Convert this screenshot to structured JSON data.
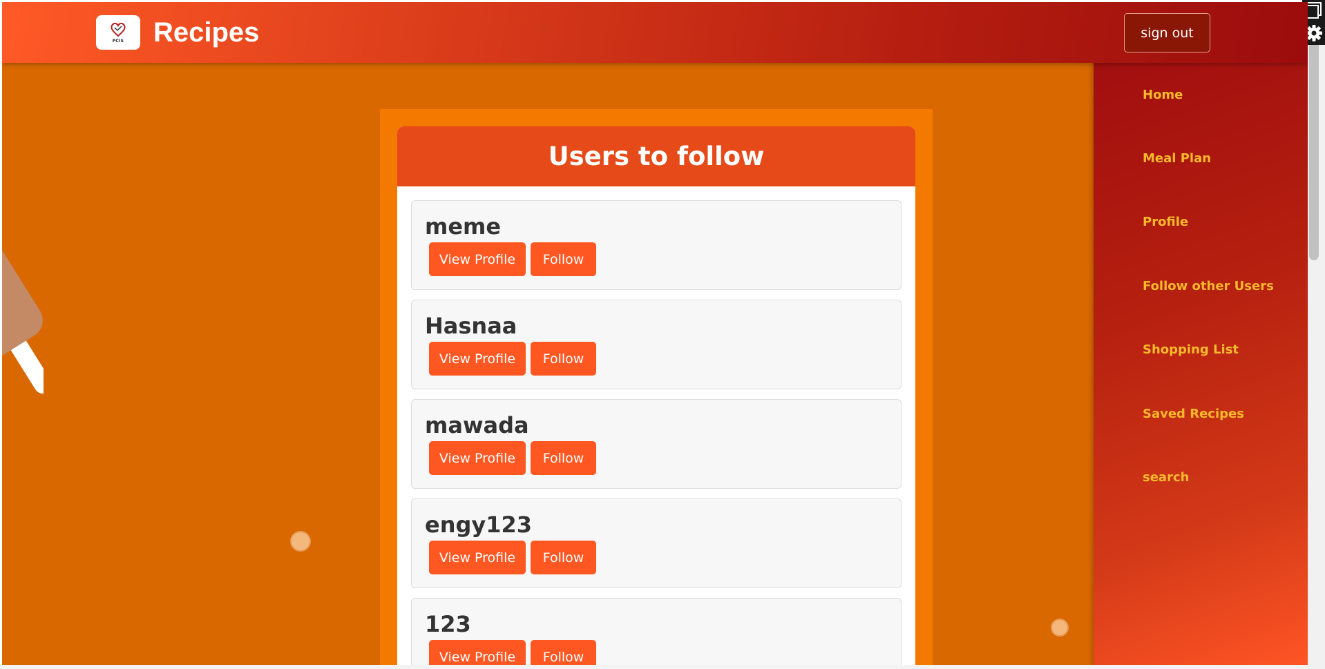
{
  "header": {
    "app_title": "Recipes",
    "logo_text": "PCIS",
    "signout_label": "sign out"
  },
  "sidebar": {
    "items": [
      {
        "label": "Home"
      },
      {
        "label": "Meal Plan"
      },
      {
        "label": "Profile"
      },
      {
        "label": "Follow other Users"
      },
      {
        "label": "Shopping List"
      },
      {
        "label": "Saved Recipes"
      },
      {
        "label": "search"
      }
    ]
  },
  "main": {
    "title": "Users to follow",
    "view_profile_label": "View Profile",
    "follow_label": "Follow",
    "users": [
      {
        "name": "meme"
      },
      {
        "name": "Hasnaa"
      },
      {
        "name": "mawada"
      },
      {
        "name": "engy123"
      },
      {
        "name": "123"
      }
    ]
  },
  "colors": {
    "page_background": "#d96800",
    "panel": "#f47900",
    "card_header": "#e64a19",
    "button": "#ff5722",
    "nav_text": "#f7b92c"
  }
}
